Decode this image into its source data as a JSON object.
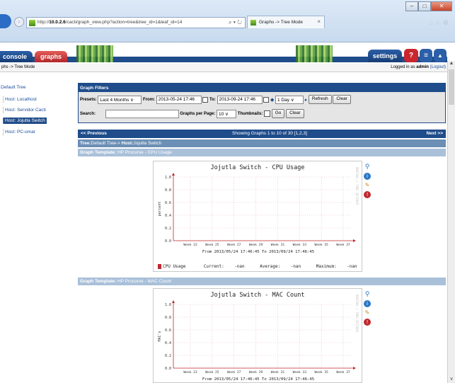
{
  "browser": {
    "url_host": "10.0.2.6",
    "url_prefix": "http://",
    "url_path": "/cacti/graph_view.php?action=tree&tree_id=1&leaf_id=14",
    "addr_controls": "⌕ ▾ ↻",
    "tab_title": "Graphs -> Tree Mode",
    "tab_close": "×",
    "win_min": "–",
    "win_max": "□",
    "win_close": "✕",
    "top_icons": "⌂☆⚙"
  },
  "header": {
    "console_tab": "console",
    "graphs_tab": "graphs",
    "settings_button": "settings",
    "help_glyph": "?",
    "list_glyph": "≡",
    "chart_glyph": "▲"
  },
  "breadcrumb": "phs -> Tree Mode",
  "login": {
    "prefix": "Logged in as ",
    "user": "admin",
    "logout": "(Logout)"
  },
  "tree": {
    "root": "Default Tree",
    "items": [
      {
        "label": "Host: Localhost",
        "selected": false
      },
      {
        "label": "Host: Servidor Cacti",
        "selected": false
      },
      {
        "label": "Host: Jojutla Switch",
        "selected": true
      },
      {
        "label": "Host: PC-omar",
        "selected": false
      }
    ]
  },
  "filters": {
    "title": "Graph Filters",
    "presets_label": "Presets:",
    "presets_value": "Last 4 Months",
    "from_label": "From:",
    "from_value": "2013-05-24 17:46",
    "to_label": "To:",
    "to_value": "2013-09-24 17:46",
    "timespan_value": "1 Day",
    "refresh_label": "Refresh",
    "clear_label": "Clear",
    "search_label": "Search:",
    "search_value": "",
    "gpp_label": "Graphs per Page:",
    "gpp_value": "10",
    "thumbs_label": "Thumbnails:",
    "go_label": "Go",
    "clear2_label": "Clear",
    "dropdown_glyph": "∨",
    "shift_glyph": "◆",
    "shift_right": "▸"
  },
  "pager": {
    "prev": "<< Previous",
    "showing": "Showing Graphs 1 to 10 of 30 [1,2,3]",
    "next": "Next >>"
  },
  "tree_path": {
    "label": "Tree:",
    "tree": "Default Tree",
    "sep": "-> ",
    "host_label": "Host:",
    "host": "Jojutla Switch"
  },
  "graphs": [
    {
      "template_label": "Graph Template:",
      "template": "HP Procurve - CPU Usage",
      "title": "Jojutla Switch - CPU Usage",
      "ylabel": "percent",
      "yticks": [
        "1.0",
        "0.8",
        "0.6",
        "0.4",
        "0.2",
        "0.0"
      ],
      "xticks": [
        "Week 23",
        "Week 25",
        "Week 27",
        "Week 29",
        "Week 31",
        "Week 33",
        "Week 35",
        "Week 37"
      ],
      "range": "From 2013/05/24 17:46:45 To 2013/09/24 17:46:45",
      "vertical_text": "RRDTOOL / TOBI OETIKER",
      "legend": {
        "name": "CPU Usage",
        "current": "Current:    -nan",
        "average": "Average:    -nan",
        "maximum": "Maximum:    -nan"
      }
    },
    {
      "template_label": "Graph Template:",
      "template": "HP Procurve - MAC Count",
      "title": "Jojutla Switch - MAC Count",
      "ylabel": "MAC's",
      "yticks": [
        "1.0",
        "0.8",
        "0.6",
        "0.4",
        "0.2",
        "0.0"
      ],
      "xticks": [
        "Week 23",
        "Week 25",
        "Week 27",
        "Week 29",
        "Week 31",
        "Week 33",
        "Week 35",
        "Week 37"
      ],
      "range": "From 2013/05/24 17:46:45 To 2013/09/24 17:46:45",
      "vertical_text": "RRDTOOL / TOBI OETIKER"
    }
  ],
  "icons": {
    "zoom": "⚲",
    "info": "i",
    "edit": "✎",
    "delete": "!"
  },
  "colors": {
    "navy": "#1f4c8a",
    "red": "#c1272d"
  },
  "scroll": {
    "up": "▲",
    "down": "∨"
  }
}
